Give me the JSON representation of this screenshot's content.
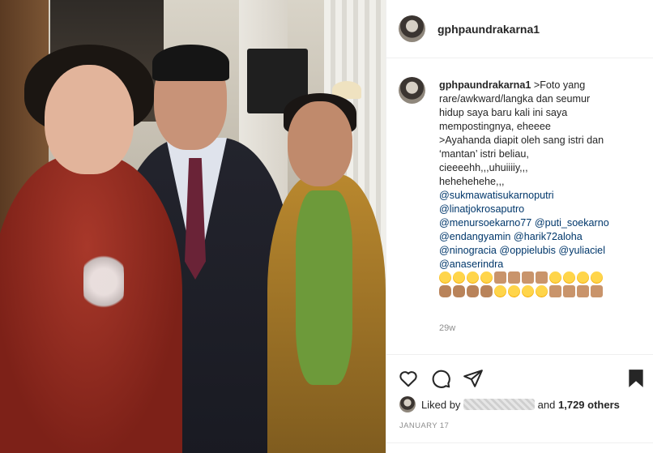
{
  "header": {
    "username": "gphpaundrakarna1"
  },
  "caption": {
    "username": "gphpaundrakarna1",
    "lines": [
      ">Foto yang",
      "rare/awkward/langka dan seumur",
      "hidup saya baru kali ini saya",
      "mempostingnya, eheeee",
      ">Ayahanda diapit oleh sang istri dan",
      "‘mantan’ istri beliau,",
      "cieeeehh,,,uhuiiiiy,,,",
      "hehehehehe,,,"
    ],
    "mentions": [
      "@sukmawatisukarnoputri",
      "@linatjokrosaputro",
      "@menursoekarno77",
      "@puti_soekarno",
      "@endangyamin",
      "@harik72aloha",
      "@ninogracia",
      "@oppielubis",
      "@yuliaciel",
      "@anaserindra"
    ],
    "emoji_rows": [
      [
        "grin",
        "grin",
        "grin",
        "grin",
        "thumb",
        "thumb",
        "thumb",
        "thumb",
        "grin",
        "grin",
        "grin",
        "grin"
      ],
      [
        "fold",
        "fold",
        "fold",
        "fold",
        "grin",
        "grin",
        "grin",
        "grin",
        "thumb",
        "thumb",
        "thumb",
        "thumb"
      ]
    ],
    "time_ago": "29w"
  },
  "actions": {
    "like_icon": "heart-icon",
    "comment_icon": "comment-icon",
    "share_icon": "paper-plane-icon",
    "save_icon": "bookmark-icon"
  },
  "likes": {
    "prefix": "Liked by",
    "suffix": "and",
    "others": "1,729 others"
  },
  "date": "JANUARY 17"
}
